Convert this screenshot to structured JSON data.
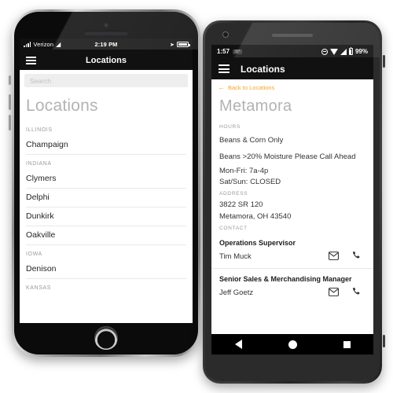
{
  "iphone": {
    "status": {
      "carrier": "Verizon",
      "time": "2:19 PM",
      "signal_icon": "signal-bars-icon",
      "wifi_icon": "wifi-icon",
      "location_icon": "location-arrow-icon",
      "battery_icon": "battery-icon"
    },
    "nav": {
      "menu_icon": "hamburger-menu-icon",
      "title": "Locations"
    },
    "search": {
      "placeholder": "Search"
    },
    "page_title": "Locations",
    "groups": [
      {
        "label": "ILLINOIS",
        "items": [
          "Champaign"
        ]
      },
      {
        "label": "INDIANA",
        "items": [
          "Clymers",
          "Delphi",
          "Dunkirk",
          "Oakville"
        ]
      },
      {
        "label": "IOWA",
        "items": [
          "Denison"
        ]
      },
      {
        "label": "KANSAS",
        "items": []
      }
    ]
  },
  "android": {
    "status": {
      "time": "1:57",
      "badge": "30°",
      "dnd_icon": "do-not-disturb-icon",
      "wifi_icon": "wifi-icon",
      "signal_icon": "signal-icon",
      "battery_icon": "battery-icon",
      "battery_pct": "99%"
    },
    "nav": {
      "menu_icon": "hamburger-menu-icon",
      "title": "Locations"
    },
    "back_link": {
      "arrow_icon": "arrow-left-icon",
      "label": "Back to Locations",
      "color": "#f5a623"
    },
    "page_title": "Metamora",
    "sections": {
      "hours_label": "HOURS",
      "hours_lines": [
        "Beans & Corn Only",
        "Beans >20% Moisture Please Call Ahead"
      ],
      "hours_schedule": [
        "Mon-Fri: 7a-4p",
        "Sat/Sun: CLOSED"
      ],
      "address_label": "ADDRESS",
      "address_lines": [
        "3822 SR 120",
        "Metamora, OH 43540"
      ],
      "contact_label": "CONTACT",
      "contacts": [
        {
          "role": "Operations Supervisor",
          "name": "Tim Muck",
          "email_icon": "envelope-icon",
          "phone_icon": "phone-icon"
        },
        {
          "role": "Senior Sales & Merchandising Manager",
          "name": "Jeff Goetz",
          "email_icon": "envelope-icon",
          "phone_icon": "phone-icon"
        }
      ]
    },
    "sysnav": {
      "back_icon": "android-back-icon",
      "home_icon": "android-home-icon",
      "recents_icon": "android-recents-icon"
    }
  }
}
